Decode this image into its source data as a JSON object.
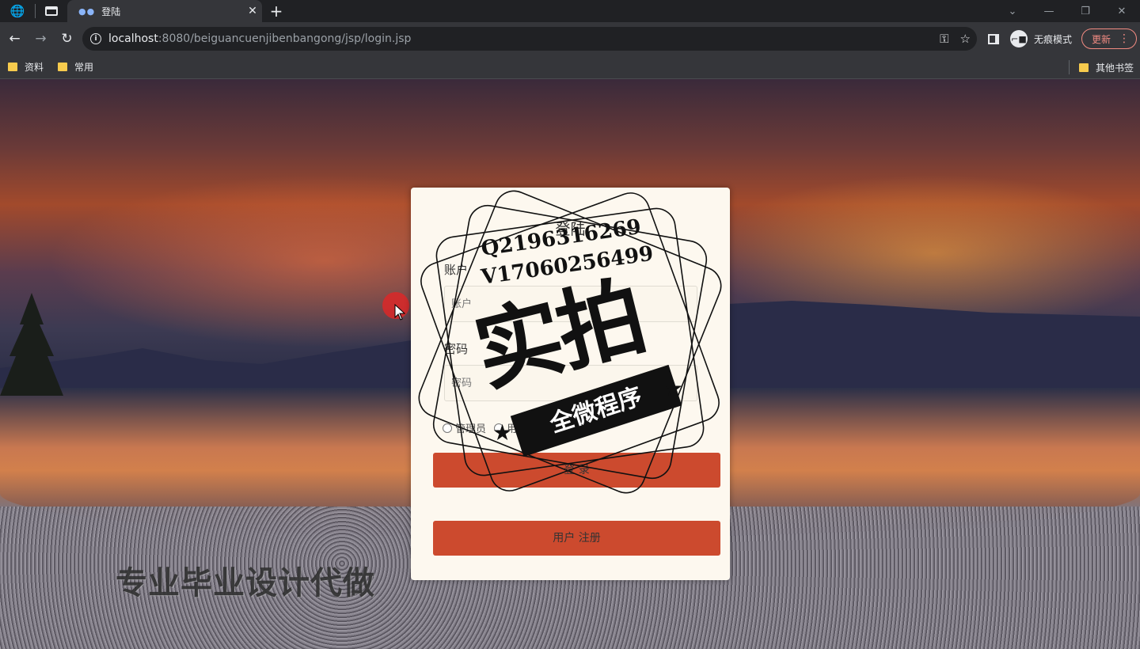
{
  "browser": {
    "tab_title": "登陆",
    "new_tab": "+",
    "url_host": "localhost",
    "url_rest": ":8080/beiguancuenjibenbangong/jsp/login.jsp",
    "incognito_label": "无痕模式",
    "update_label": "更新",
    "bookmarks": [
      "资料",
      "常用"
    ],
    "other_bookmarks": "其他书签"
  },
  "login": {
    "title": "登陆",
    "account_label": "账户",
    "account_placeholder": "账户",
    "password_label": "密码",
    "password_placeholder": "密码",
    "roles": [
      "管理员",
      "用户"
    ],
    "login_button": "登 录",
    "register_button": "用户 注册"
  },
  "overlay": {
    "contact_q": "Q2196316269",
    "contact_v": "V17060256499",
    "stamp_main": "实拍",
    "stamp_banner": "全微程序",
    "bottom_watermark": "专业毕业设计代做"
  },
  "colors": {
    "button_bg": "#cc4a2e",
    "card_bg": "#fdf8ef",
    "update_accent": "#f28b82"
  }
}
